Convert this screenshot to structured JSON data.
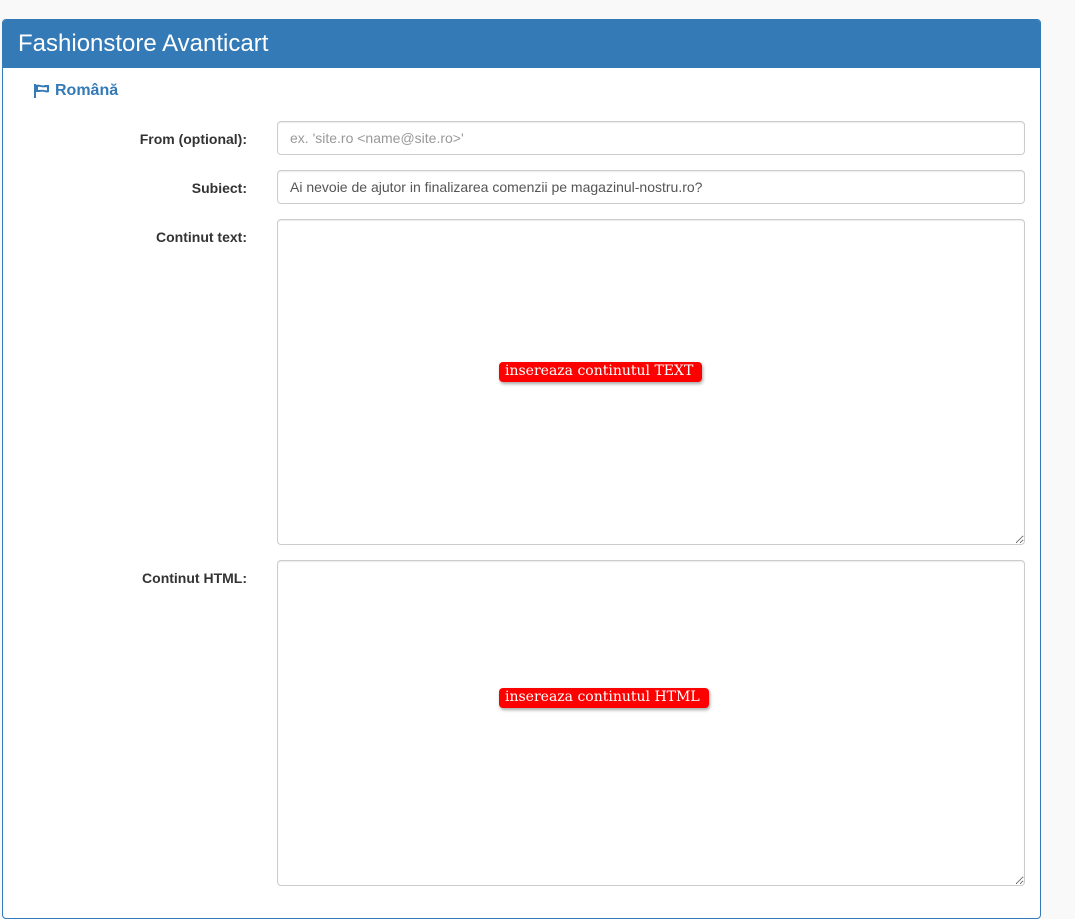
{
  "panel": {
    "title": "Fashionstore Avanticart",
    "accent_color": "#337ab7"
  },
  "language": {
    "icon": "flag-icon",
    "label": "Română"
  },
  "form": {
    "from": {
      "label": "From (optional):",
      "value": "",
      "placeholder": "ex. 'site.ro <name@site.ro>'"
    },
    "subject": {
      "label": "Subiect:",
      "value": "Ai nevoie de ajutor in finalizarea comenzii pe magazinul-nostru.ro?"
    },
    "text_content": {
      "label": "Continut text:",
      "hint": "insereaza continutul TEXT"
    },
    "html_content": {
      "label": "Continut HTML:",
      "hint": "insereaza continutul HTML"
    }
  },
  "colors": {
    "hint_background": "#ff0000"
  }
}
